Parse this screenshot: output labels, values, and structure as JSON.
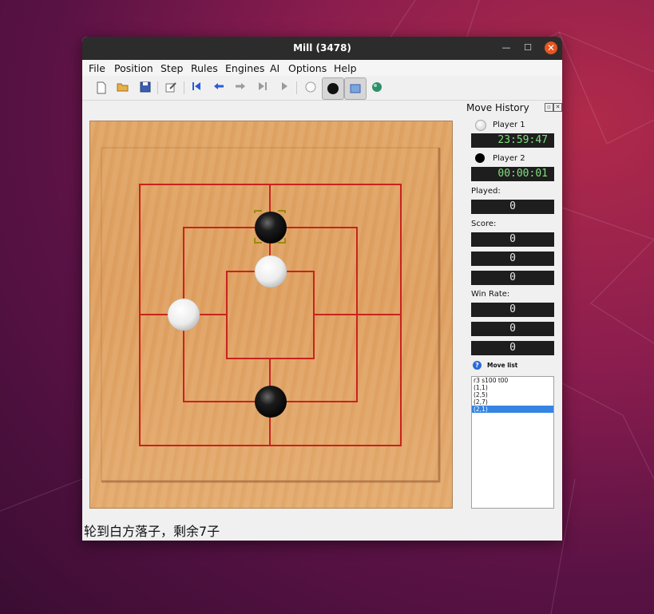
{
  "window": {
    "title": "Mill (3478)"
  },
  "menu": [
    "File",
    "Position",
    "Step",
    "Rules",
    "Engines",
    "AI",
    "Options",
    "Help"
  ],
  "toolbar": [
    {
      "name": "new-icon",
      "glyph": "🗋"
    },
    {
      "name": "open-icon",
      "glyph": "📂"
    },
    {
      "name": "save-icon",
      "glyph": "💾"
    },
    {
      "name": "edit-icon",
      "glyph": "✎"
    },
    {
      "name": "first-step-icon",
      "glyph": "⏮"
    },
    {
      "name": "prev-step-icon",
      "glyph": "⇦"
    },
    {
      "name": "next-step-icon",
      "glyph": "⇨"
    },
    {
      "name": "last-step-icon",
      "glyph": "⏭"
    },
    {
      "name": "play-icon",
      "glyph": "▶"
    },
    {
      "name": "white-player-icon",
      "glyph": "●"
    },
    {
      "name": "black-player-icon",
      "glyph": "●"
    },
    {
      "name": "engine-vs-engine-icon",
      "glyph": "▣"
    },
    {
      "name": "globe-icon",
      "glyph": "●"
    }
  ],
  "board": {
    "pieces": [
      {
        "color": "black",
        "ring": "outer",
        "point": "top-middle",
        "selected": true
      },
      {
        "color": "white",
        "ring": "inner",
        "point": "top-middle"
      },
      {
        "color": "white",
        "ring": "middle",
        "point": "left-middle"
      },
      {
        "color": "black",
        "ring": "middle",
        "point": "bottom-middle"
      }
    ],
    "line_color": "#c8231e"
  },
  "status": "轮到白方落子，剩余7子",
  "history": {
    "title": "Move History",
    "player1": {
      "label": "Player 1",
      "time": "23:59:47"
    },
    "player2": {
      "label": "Player 2",
      "time": "00:00:01"
    },
    "played_label": "Played:",
    "played": "0",
    "score_label": "Score:",
    "scores": [
      "0",
      "0",
      "0"
    ],
    "winrate_label": "Win Rate:",
    "winrates": [
      "0",
      "0",
      "0"
    ],
    "movelist_label": "Move list",
    "moves": [
      "r3 s100 t00",
      "(1,1)",
      "(2,5)",
      "(2,7)",
      "(2,1)"
    ],
    "selected_move": 4
  }
}
